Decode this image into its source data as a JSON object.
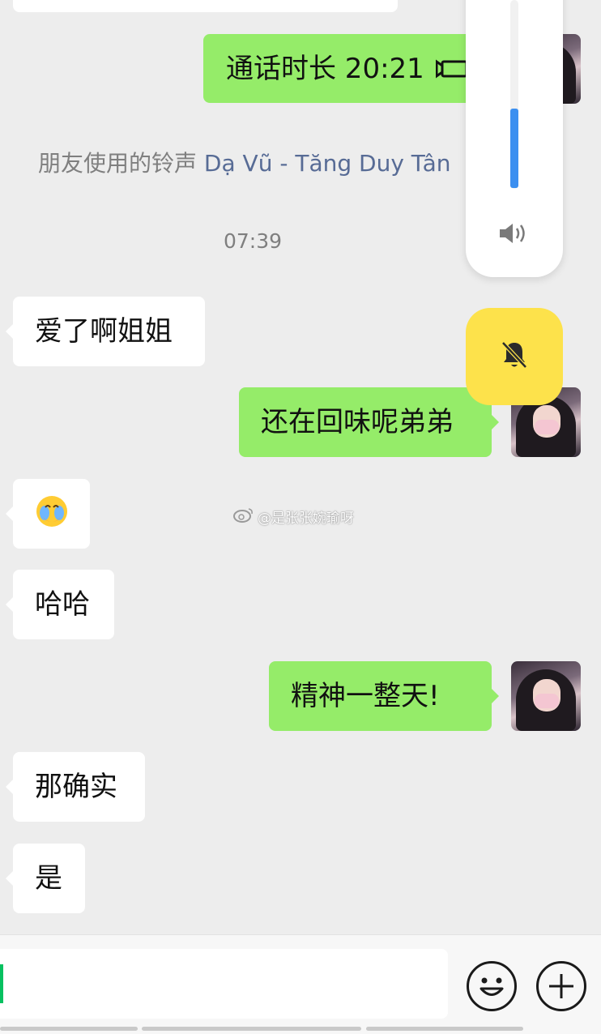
{
  "call_duration": {
    "text": "通话时长 20:21",
    "icon": "video-call-icon"
  },
  "ringtone": {
    "prefix": "朋友使用的铃声",
    "song": "Dạ Vũ - Tăng Duy Tân"
  },
  "timestamp": "07:39",
  "messages": [
    {
      "side": "in",
      "text": "爱了啊姐姐"
    },
    {
      "side": "out",
      "text": "还在回味呢弟弟"
    },
    {
      "side": "in",
      "text": "",
      "emoji": "face-with-hand-over-mouth-crying-emoji"
    },
    {
      "side": "in",
      "text": "哈哈"
    },
    {
      "side": "out",
      "text": "精神一整天!"
    },
    {
      "side": "in",
      "text": "那确实"
    },
    {
      "side": "in",
      "text": "是"
    }
  ],
  "watermark": "@是张张婉瑜呀",
  "volume_panel": {
    "level": 0.42,
    "icon": "speaker-icon",
    "mute_icon": "bell-muted-icon",
    "accent": "#3b8ff0"
  },
  "colors": {
    "outgoing": "#95ec69",
    "incoming": "#ffffff",
    "background": "#ededed",
    "bell_button": "#fde24b"
  },
  "input": {
    "value": "",
    "emoji_icon": "emoji-icon",
    "plus_icon": "plus-icon"
  }
}
